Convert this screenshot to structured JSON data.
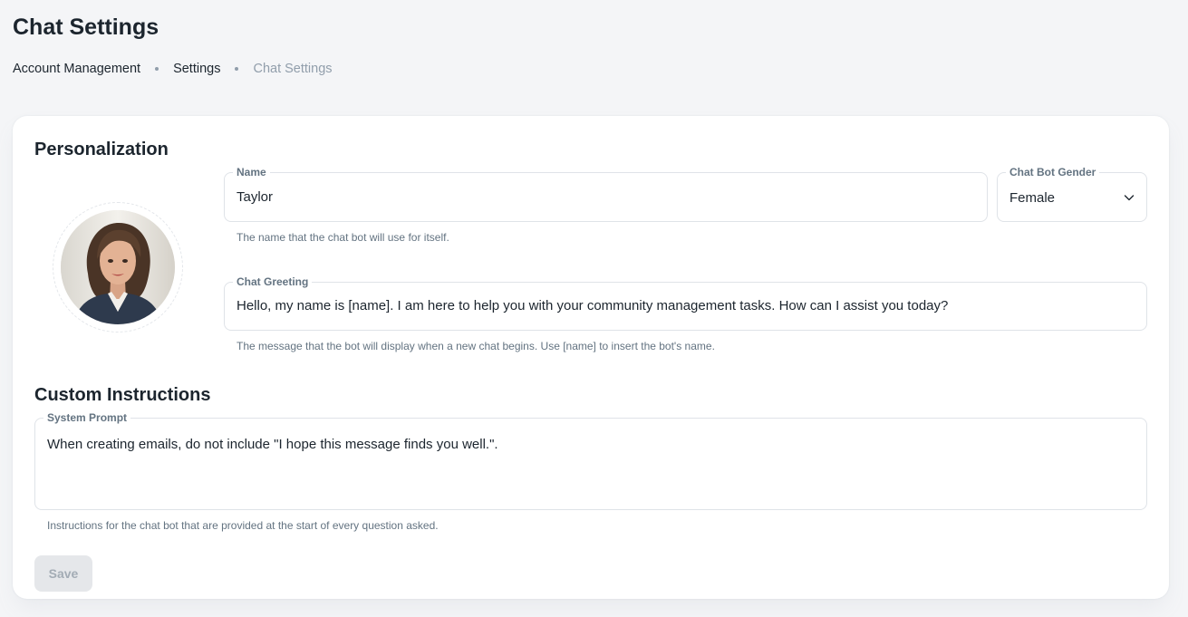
{
  "header": {
    "title": "Chat Settings",
    "breadcrumb": [
      "Account Management",
      "Settings",
      "Chat Settings"
    ]
  },
  "personalization": {
    "title": "Personalization",
    "avatar_alt": "chat bot avatar",
    "name": {
      "label": "Name",
      "value": "Taylor",
      "helper": "The name that the chat bot will use for itself."
    },
    "gender": {
      "label": "Chat Bot Gender",
      "value": "Female"
    },
    "greeting": {
      "label": "Chat Greeting",
      "value": "Hello, my name is [name]. I am here to help you with your community management tasks. How can I assist you today?",
      "helper": "The message that the bot will display when a new chat begins. Use [name] to insert the bot's name."
    }
  },
  "custom_instructions": {
    "title": "Custom Instructions",
    "system_prompt": {
      "label": "System Prompt",
      "value": "When creating emails, do not include \"I hope this message finds you well.\".",
      "helper": "Instructions for the chat bot that are provided at the start of every question asked."
    }
  },
  "actions": {
    "save_label": "Save",
    "save_disabled": true
  }
}
